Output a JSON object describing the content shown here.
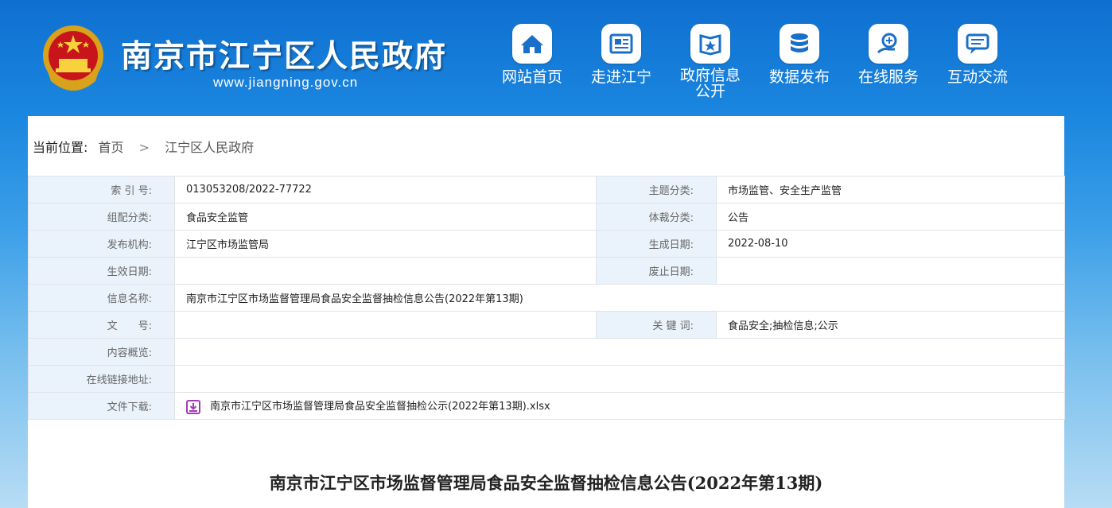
{
  "header": {
    "site_title": "南京市江宁区人民政府",
    "site_url": "www.jiangning.gov.cn",
    "nav": [
      {
        "label": "网站首页",
        "icon": "home-icon"
      },
      {
        "label": "走进江宁",
        "icon": "newspaper-icon"
      },
      {
        "label": "政府信息公开",
        "icon": "document-icon"
      },
      {
        "label": "数据发布",
        "icon": "database-icon"
      },
      {
        "label": "在线服务",
        "icon": "service-icon"
      },
      {
        "label": "互动交流",
        "icon": "chat-icon"
      }
    ]
  },
  "breadcrumb": {
    "label": "当前位置:",
    "items": [
      "首页",
      "江宁区人民政府"
    ],
    "separator": ">"
  },
  "meta": {
    "index_no_label": "索 引 号:",
    "index_no": "013053208/2022-77722",
    "topic_label": "主题分类:",
    "topic": "市场监管、安全生产监管",
    "category_label": "组配分类:",
    "category": "食品安全监管",
    "genre_label": "体裁分类:",
    "genre": "公告",
    "publisher_label": "发布机构:",
    "publisher": "江宁区市场监管局",
    "created_label": "生成日期:",
    "created": "2022-08-10",
    "effective_label": "生效日期:",
    "effective": "",
    "expired_label": "废止日期:",
    "expired": "",
    "info_name_label": "信息名称:",
    "info_name": "南京市江宁区市场监督管理局食品安全监督抽检信息公告(2022年第13期)",
    "doc_no_label": "文　　号:",
    "doc_no": "",
    "keywords_label": "关 键 词:",
    "keywords": "食品安全;抽检信息;公示",
    "summary_label": "内容概览:",
    "summary": "",
    "link_label": "在线链接地址:",
    "link": "",
    "download_label": "文件下载:",
    "download_file": "南京市江宁区市场监督管理局食品安全监督抽检公示(2022年第13期).xlsx"
  },
  "article": {
    "title": "南京市江宁区市场监督管理局食品安全监督抽检信息公告(2022年第13期)"
  },
  "colors": {
    "banner_top": "#0f6fd0",
    "label_bg": "#eaf3fb",
    "border": "#dfe3e8",
    "nav_icon_fg": "#1a6fc9",
    "download_icon": "#a23bb5"
  }
}
